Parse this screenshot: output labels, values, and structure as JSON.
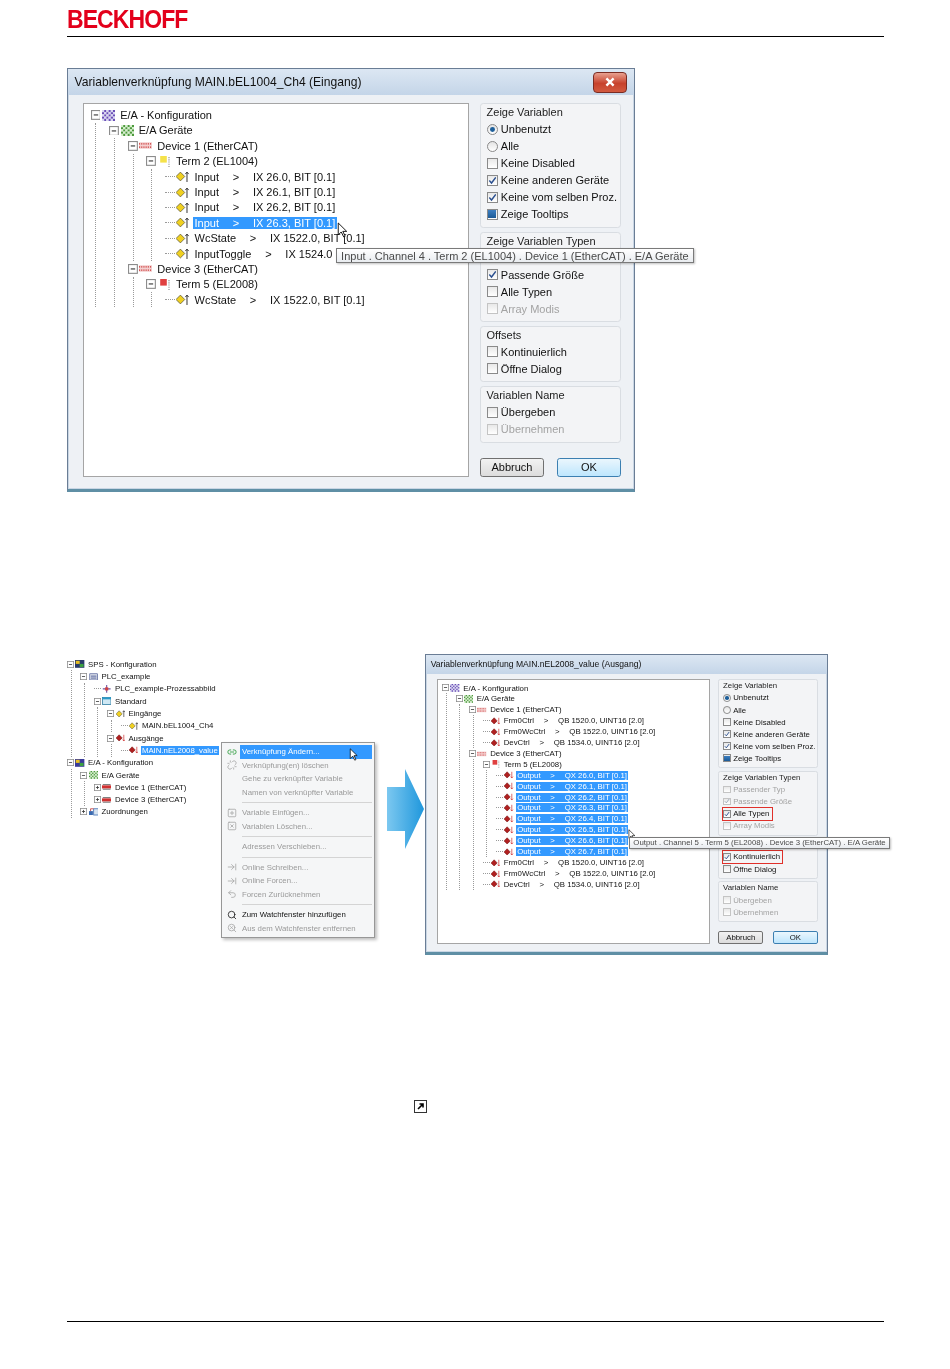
{
  "header": {
    "logo": "BECKHOFF"
  },
  "figure_1": {
    "dialog": {
      "title": "Variablenverknüpfung MAIN.bEL1004_Ch4 (Eingang)",
      "tree": [
        {
          "kind": "config",
          "label": "E/A - Konfiguration",
          "expanded": true,
          "selected": false,
          "children": [
            {
              "kind": "devices",
              "label": "E/A Geräte",
              "expanded": true,
              "selected": false,
              "children": [
                {
                  "kind": "device",
                  "label": "Device 1 (EtherCAT)",
                  "expanded": true,
                  "selected": false,
                  "children": [
                    {
                      "kind": "input-terminal",
                      "label": "Term 2 (EL1004)",
                      "expanded": true,
                      "selected": false,
                      "children": [
                        {
                          "kind": "input",
                          "name": "Input",
                          "link": ">",
                          "address": "IX 26.0, BIT [0.1]",
                          "selected": false
                        },
                        {
                          "kind": "input",
                          "name": "Input",
                          "link": ">",
                          "address": "IX 26.1, BIT [0.1]",
                          "selected": false
                        },
                        {
                          "kind": "input",
                          "name": "Input",
                          "link": ">",
                          "address": "IX 26.2, BIT [0.1]",
                          "selected": false
                        },
                        {
                          "kind": "input",
                          "name": "Input",
                          "link": ">",
                          "address": "IX 26.3, BIT [0.1]",
                          "selected": true,
                          "pointer": true
                        },
                        {
                          "kind": "input",
                          "name": "WcState",
                          "link": ">",
                          "address": "IX 1522.0, BIT [0.1]",
                          "selected": false
                        },
                        {
                          "kind": "input",
                          "name": "InputToggle",
                          "link": ">",
                          "address": "IX 1524.0",
                          "selected": false,
                          "tooltip": "Input . Channel 4 . Term 2 (EL1004) . Device 1 (EtherCAT) . E/A Geräte"
                        }
                      ]
                    }
                  ]
                },
                {
                  "kind": "device",
                  "label": "Device 3 (EtherCAT)",
                  "expanded": true,
                  "selected": false,
                  "children": [
                    {
                      "kind": "output-terminal",
                      "label": "Term 5 (EL2008)",
                      "expanded": true,
                      "selected": false,
                      "children": [
                        {
                          "kind": "input",
                          "name": "WcState",
                          "link": ">",
                          "address": "IX 1522.0, BIT [0.1]",
                          "selected": false
                        }
                      ]
                    }
                  ]
                }
              ]
            }
          ]
        }
      ],
      "option_groups": [
        {
          "title": "Zeige Variablen",
          "options": [
            {
              "kind": "radio",
              "label": "Unbenutzt",
              "selected": true,
              "disabled": false,
              "highlighted": false
            },
            {
              "kind": "radio",
              "label": "Alle",
              "selected": false,
              "disabled": false,
              "highlighted": false
            },
            {
              "kind": "checkbox",
              "label": "Keine Disabled",
              "checked": false,
              "disabled": false,
              "highlighted": false
            },
            {
              "kind": "checkbox",
              "label": "Keine anderen Geräte",
              "checked": true,
              "disabled": false,
              "highlighted": false
            },
            {
              "kind": "checkbox",
              "label": "Keine vom selben Proz.",
              "checked": true,
              "disabled": false,
              "highlighted": false
            },
            {
              "kind": "tristate",
              "label": "Zeige Tooltips",
              "checked": true,
              "disabled": false,
              "highlighted": false
            }
          ]
        },
        {
          "title": "Zeige Variablen Typen",
          "options": [
            {
              "kind": "covered"
            },
            {
              "kind": "checkbox",
              "label": "Passende Größe",
              "checked": true,
              "disabled": false,
              "highlighted": false
            },
            {
              "kind": "checkbox",
              "label": "Alle Typen",
              "checked": false,
              "disabled": false,
              "highlighted": false
            },
            {
              "kind": "checkbox",
              "label": "Array Modis",
              "checked": false,
              "disabled": true,
              "highlighted": false
            }
          ]
        },
        {
          "title": "Offsets",
          "options": [
            {
              "kind": "checkbox",
              "label": "Kontinuierlich",
              "checked": false,
              "disabled": false,
              "highlighted": false
            },
            {
              "kind": "checkbox",
              "label": "Öffne Dialog",
              "checked": false,
              "disabled": false,
              "highlighted": false
            }
          ]
        },
        {
          "title": "Variablen Name",
          "options": [
            {
              "kind": "checkbox",
              "label": "Übergeben",
              "checked": false,
              "disabled": false,
              "highlighted": false
            },
            {
              "kind": "checkbox",
              "label": "Übernehmen",
              "checked": false,
              "disabled": true,
              "highlighted": false
            }
          ]
        }
      ],
      "buttons": [
        {
          "label": "Abbruch",
          "default": false
        },
        {
          "label": "OK",
          "default": true
        }
      ]
    }
  },
  "figure_2": {
    "project_tree": [
      {
        "kind": "plc-config",
        "label": "SPS - Konfiguration",
        "expanded": true,
        "selected": false,
        "children": [
          {
            "kind": "plc-project",
            "label": "PLC_example",
            "expanded": true,
            "selected": false,
            "children": [
              {
                "kind": "process-image",
                "label": "PLC_example-Prozessabbild",
                "selected": false
              },
              {
                "kind": "task",
                "label": "Standard",
                "expanded": true,
                "selected": false,
                "children": [
                  {
                    "kind": "input-group",
                    "label": "Eingänge",
                    "expanded": true,
                    "selected": false,
                    "children": [
                      {
                        "kind": "input-variable",
                        "label": "MAIN.bEL1004_Ch4",
                        "selected": false
                      }
                    ]
                  },
                  {
                    "kind": "output-group",
                    "label": "Ausgänge",
                    "expanded": true,
                    "selected": false,
                    "children": [
                      {
                        "kind": "output-variable",
                        "label": "MAIN.nEL2008_value",
                        "selected": true
                      }
                    ]
                  }
                ]
              }
            ]
          }
        ]
      },
      {
        "kind": "io-config",
        "label": "E/A - Konfiguration",
        "expanded": true,
        "selected": false,
        "children": [
          {
            "kind": "devices",
            "label": "E/A Geräte",
            "expanded": true,
            "selected": false,
            "children": [
              {
                "kind": "ethercat-device",
                "label": "Device 1 (EtherCAT)",
                "expanded": false,
                "selected": false
              },
              {
                "kind": "ethercat-device",
                "label": "Device 3 (EtherCAT)",
                "expanded": false,
                "selected": false
              }
            ]
          },
          {
            "kind": "mappings",
            "label": "Zuordnungen",
            "expanded": false,
            "selected": false
          }
        ]
      }
    ],
    "context_menu": [
      {
        "kind": "item",
        "label": "Verknüpfung Ändern...",
        "selected": true,
        "disabled": false,
        "pointer": true
      },
      {
        "kind": "item",
        "label": "Verknüpfung(en) löschen",
        "selected": false,
        "disabled": true
      },
      {
        "kind": "item",
        "label": "Gehe zu verknüpfter Variable",
        "selected": false,
        "disabled": true
      },
      {
        "kind": "item",
        "label": "Namen von verknüpfter Variable",
        "selected": false,
        "disabled": true
      },
      {
        "kind": "separator"
      },
      {
        "kind": "item",
        "label": "Variable Einfügen...",
        "selected": false,
        "disabled": true
      },
      {
        "kind": "item",
        "label": "Variablen Löschen...",
        "selected": false,
        "disabled": true
      },
      {
        "kind": "separator"
      },
      {
        "kind": "item",
        "label": "Adressen Verschieben...",
        "selected": false,
        "disabled": true
      },
      {
        "kind": "separator"
      },
      {
        "kind": "item",
        "label": "Online Schreiben...",
        "selected": false,
        "disabled": true
      },
      {
        "kind": "item",
        "label": "Online Forcen...",
        "selected": false,
        "disabled": true
      },
      {
        "kind": "item",
        "label": "Forcen Zurücknehmen",
        "selected": false,
        "disabled": true
      },
      {
        "kind": "separator"
      },
      {
        "kind": "item",
        "label": "Zum Watchfenster hinzufügen",
        "selected": false,
        "disabled": false
      },
      {
        "kind": "item",
        "label": "Aus dem Watchfenster entfernen",
        "selected": false,
        "disabled": true
      }
    ],
    "dialog": {
      "title": "Variablenverknüpfung MAIN.nEL2008_value (Ausgang)",
      "tree": [
        {
          "kind": "config",
          "label": "E/A - Konfiguration",
          "expanded": true,
          "selected": false,
          "children": [
            {
              "kind": "devices",
              "label": "E/A Geräte",
              "expanded": true,
              "selected": false,
              "children": [
                {
                  "kind": "device",
                  "label": "Device 1 (EtherCAT)",
                  "expanded": true,
                  "selected": false,
                  "children": [
                    {
                      "kind": "output",
                      "name": "Frm0Ctrl",
                      "link": ">",
                      "address": "QB 1520.0, UINT16 [2.0]",
                      "selected": false
                    },
                    {
                      "kind": "output",
                      "name": "Frm0WcCtrl",
                      "link": ">",
                      "address": "QB 1522.0, UINT16 [2.0]",
                      "selected": false
                    },
                    {
                      "kind": "output",
                      "name": "DevCtrl",
                      "link": ">",
                      "address": "QB 1534.0, UINT16 [2.0]",
                      "selected": false
                    }
                  ]
                },
                {
                  "kind": "device",
                  "label": "Device 3 (EtherCAT)",
                  "expanded": true,
                  "selected": false,
                  "children": [
                    {
                      "kind": "output-terminal",
                      "label": "Term 5 (EL2008)",
                      "expanded": true,
                      "selected": false,
                      "children": [
                        {
                          "kind": "output",
                          "name": "Output",
                          "link": ">",
                          "address": "QX 26.0, BIT [0.1]",
                          "selected": true
                        },
                        {
                          "kind": "output",
                          "name": "Output",
                          "link": ">",
                          "address": "QX 26.1, BIT [0.1]",
                          "selected": true
                        },
                        {
                          "kind": "output",
                          "name": "Output",
                          "link": ">",
                          "address": "QX 26.2, BIT [0.1]",
                          "selected": true
                        },
                        {
                          "kind": "output",
                          "name": "Output",
                          "link": ">",
                          "address": "QX 26.3, BIT [0.1]",
                          "selected": true
                        },
                        {
                          "kind": "output",
                          "name": "Output",
                          "link": ">",
                          "address": "QX 26.4, BIT [0.1]",
                          "selected": true
                        },
                        {
                          "kind": "output",
                          "name": "Output",
                          "link": ">",
                          "address": "QX 26.5, BIT [0.1]",
                          "selected": true,
                          "pointer": true
                        },
                        {
                          "kind": "output",
                          "name": "Output",
                          "link": ">",
                          "address": "QX 26.6, BIT [0.1]",
                          "selected": true,
                          "tooltip": "Output . Channel 5 . Term 5 (EL2008) . Device 3 (EtherCAT) . E/A Geräte"
                        },
                        {
                          "kind": "output",
                          "name": "Output",
                          "link": ">",
                          "address": "QX 26.7, BIT [0.1]",
                          "selected": true
                        }
                      ]
                    },
                    {
                      "kind": "output",
                      "name": "Frm0Ctrl",
                      "link": ">",
                      "address": "QB 1520.0, UINT16 [2.0]",
                      "selected": false
                    },
                    {
                      "kind": "output",
                      "name": "Frm0WcCtrl",
                      "link": ">",
                      "address": "QB 1522.0, UINT16 [2.0]",
                      "selected": false
                    },
                    {
                      "kind": "output",
                      "name": "DevCtrl",
                      "link": ">",
                      "address": "QB 1534.0, UINT16 [2.0]",
                      "selected": false
                    }
                  ]
                }
              ]
            }
          ]
        }
      ],
      "option_groups": [
        {
          "title": "Zeige Variablen",
          "options": [
            {
              "kind": "radio",
              "label": "Unbenutzt",
              "selected": true,
              "disabled": false,
              "highlighted": false
            },
            {
              "kind": "radio",
              "label": "Alle",
              "selected": false,
              "disabled": false,
              "highlighted": false
            },
            {
              "kind": "checkbox",
              "label": "Keine Disabled",
              "checked": false,
              "disabled": false,
              "highlighted": false
            },
            {
              "kind": "checkbox",
              "label": "Keine anderen Geräte",
              "checked": true,
              "disabled": false,
              "highlighted": false
            },
            {
              "kind": "checkbox",
              "label": "Keine vom selben Proz.",
              "checked": true,
              "disabled": false,
              "highlighted": false
            },
            {
              "kind": "tristate",
              "label": "Zeige Tooltips",
              "checked": true,
              "disabled": false,
              "highlighted": false
            }
          ]
        },
        {
          "title": "Zeige Variablen Typen",
          "options": [
            {
              "kind": "checkbox",
              "label": "Passender Typ",
              "checked": false,
              "disabled": true,
              "highlighted": false
            },
            {
              "kind": "checkbox",
              "label": "Passende Größe",
              "checked": true,
              "disabled": true,
              "highlighted": false
            },
            {
              "kind": "checkbox",
              "label": "Alle Typen",
              "checked": true,
              "disabled": false,
              "highlighted": true
            },
            {
              "kind": "checkbox",
              "label": "Array Modis",
              "checked": false,
              "disabled": true,
              "highlighted": false
            }
          ]
        },
        {
          "options": [
            {
              "kind": "checkbox",
              "label": "Kontinuierlich",
              "checked": true,
              "disabled": false,
              "highlighted": true
            },
            {
              "kind": "checkbox",
              "label": "Öffne Dialog",
              "checked": false,
              "disabled": false,
              "highlighted": false
            }
          ]
        },
        {
          "title": "Variablen Name",
          "options": [
            {
              "kind": "checkbox",
              "label": "Übergeben",
              "checked": false,
              "disabled": true,
              "highlighted": false
            },
            {
              "kind": "checkbox",
              "label": "Übernehmen",
              "checked": false,
              "disabled": true,
              "highlighted": false
            }
          ]
        }
      ],
      "buttons": [
        {
          "label": "Abbruch",
          "default": false
        },
        {
          "label": "OK",
          "default": true
        }
      ]
    }
  }
}
